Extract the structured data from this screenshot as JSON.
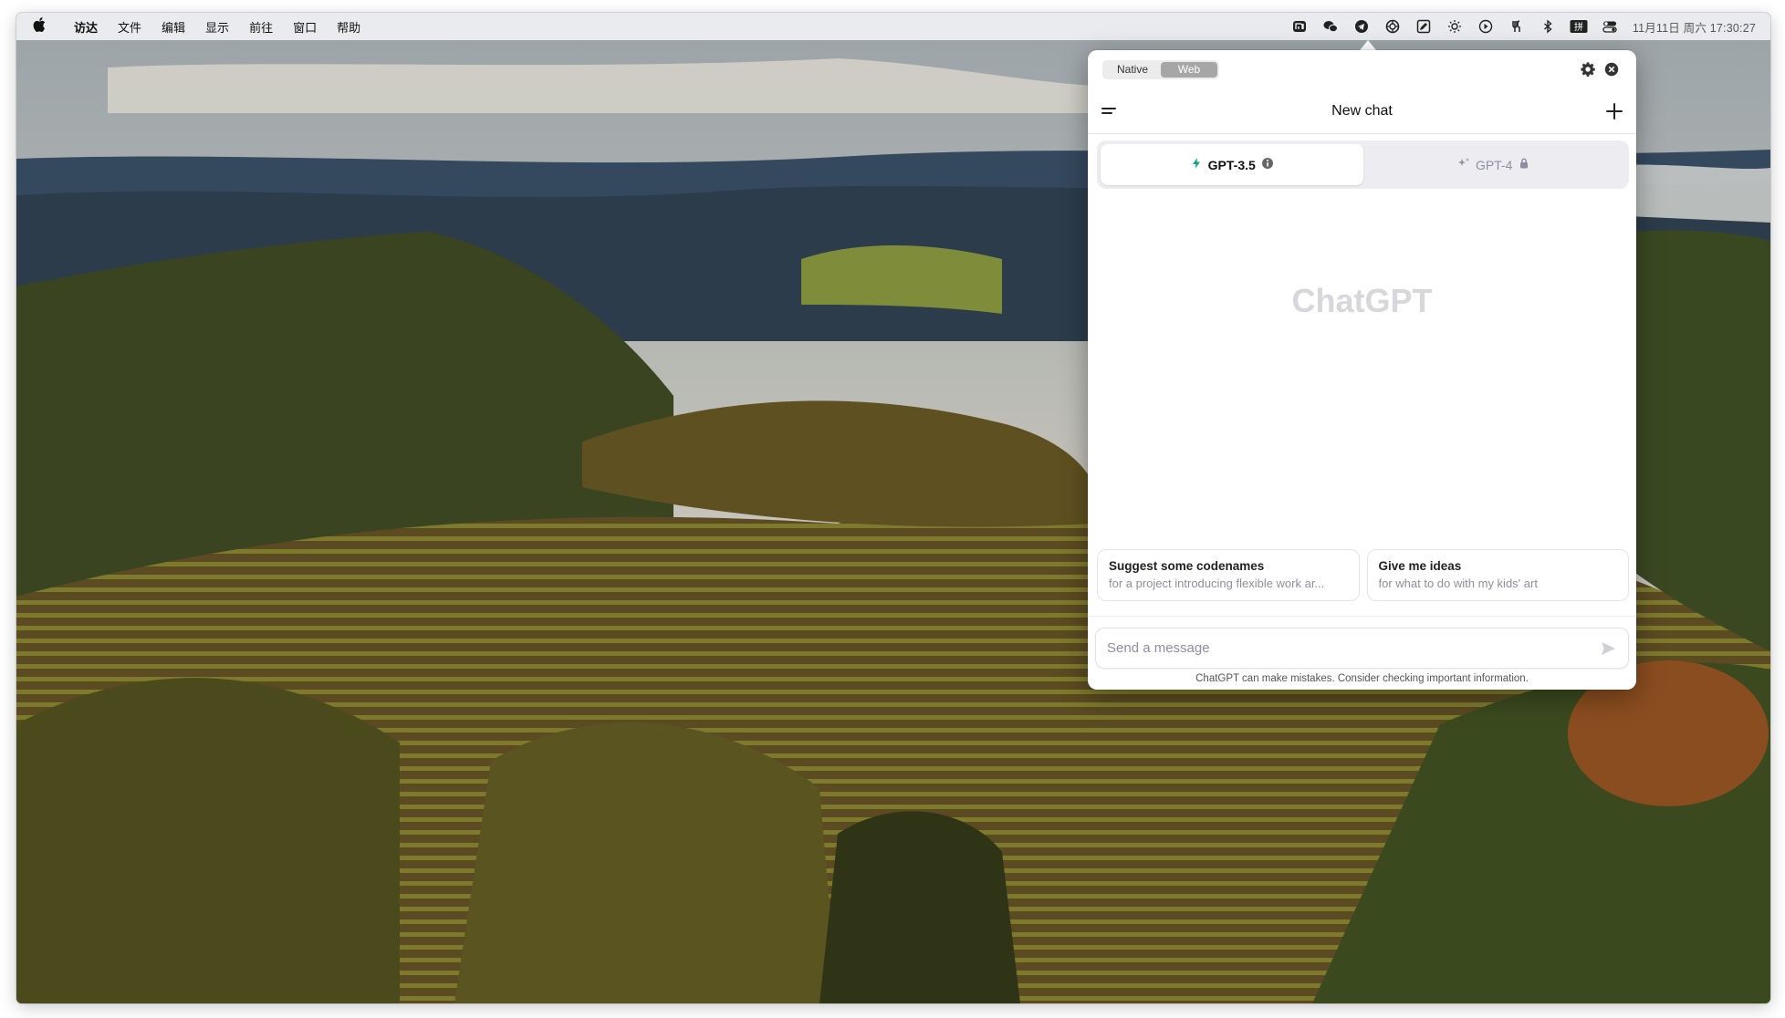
{
  "menubar": {
    "apple_icon": "apple-icon",
    "items": [
      "访达",
      "文件",
      "编辑",
      "显示",
      "前往",
      "窗口",
      "帮助"
    ],
    "tray_icons": [
      "mi-icon",
      "wechat-icon",
      "telegram-icon",
      "chatgpt-icon",
      "edit-icon",
      "brightness-icon",
      "play-icon",
      "fork-icon",
      "bluetooth-icon",
      "input-method-icon",
      "control-center-icon"
    ],
    "input_method_label": "拼",
    "clock": "11月11日 周六 17:30:27"
  },
  "chatgpt": {
    "mode_tabs": [
      {
        "label": "Native",
        "active": false
      },
      {
        "label": "Web",
        "active": true
      }
    ],
    "header_title": "New chat",
    "models": [
      {
        "label": "GPT-3.5",
        "active": true,
        "icon": "bolt-icon",
        "suffix_icon": "info-icon"
      },
      {
        "label": "GPT-4",
        "active": false,
        "icon": "sparkle-icon",
        "suffix_icon": "lock-icon"
      }
    ],
    "brand": "ChatGPT",
    "suggestions": [
      {
        "title": "Suggest some codenames",
        "subtitle": "for a project introducing flexible work ar..."
      },
      {
        "title": "Give me ideas",
        "subtitle": "for what to do with my kids' art"
      }
    ],
    "composer_placeholder": "Send a message",
    "disclaimer": "ChatGPT can make mistakes. Consider checking important information.",
    "colors": {
      "accent": "#10a37f",
      "active_tab": "#a6a6a6"
    }
  }
}
